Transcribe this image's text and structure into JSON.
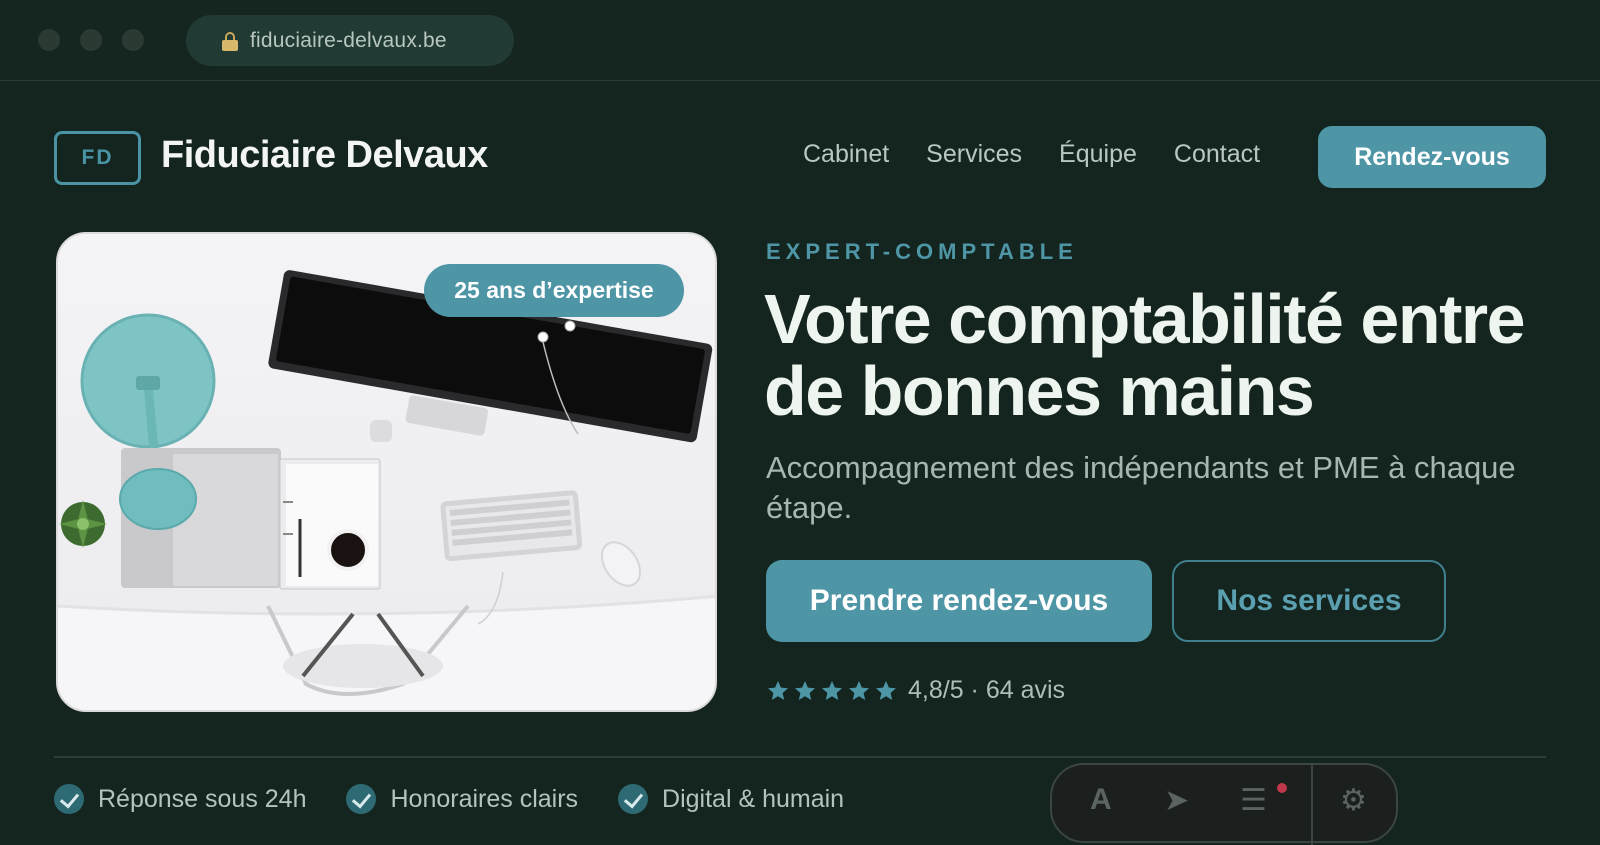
{
  "browser": {
    "url": "fiduciaire-delvaux.be"
  },
  "header": {
    "logo_initials": "FD",
    "brand_name": "Fiduciaire Delvaux",
    "nav": [
      "Cabinet",
      "Services",
      "Équipe",
      "Contact"
    ],
    "cta_label": "Rendez-vous"
  },
  "hero": {
    "image_badge": "25 ans d’expertise",
    "eyebrow": "EXPERT-COMPTABLE",
    "headline": "Votre comptabilité entre de bonnes mains",
    "subhead": "Accompagnement des indépendants et PME à chaque étape.",
    "primary_button": "Prendre rendez-vous",
    "secondary_button": "Nos services",
    "rating": {
      "stars": 5,
      "text": "4,8/5 · 64 avis"
    }
  },
  "features": [
    {
      "label": "Réponse sous 24h"
    },
    {
      "label": "Honoraires clairs"
    },
    {
      "label": "Digital & humain"
    }
  ],
  "colors": {
    "background": "#14251f",
    "accent": "#4e95a6",
    "headline": "#eef4ee",
    "muted_text": "#a6b6b0"
  }
}
